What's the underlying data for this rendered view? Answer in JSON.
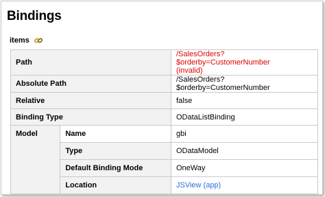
{
  "header": {
    "title": "Bindings"
  },
  "section": {
    "label": "items",
    "icon": "chain-link-icon"
  },
  "rows": {
    "path": {
      "label": "Path",
      "value_line1": "/SalesOrders?$orderby=CustomerNumber",
      "value_line2": "(invalid)"
    },
    "absolute_path": {
      "label": "Absolute Path",
      "value": "/SalesOrders?$orderby=CustomerNumber"
    },
    "relative": {
      "label": "Relative",
      "value": "false"
    },
    "binding_type": {
      "label": "Binding Type",
      "value": "ODataListBinding"
    },
    "model": {
      "label": "Model",
      "name": {
        "label": "Name",
        "value": "gbi"
      },
      "type": {
        "label": "Type",
        "value": "ODataModel"
      },
      "default_binding_mode": {
        "label": "Default Binding Mode",
        "value": "OneWay"
      },
      "location": {
        "label": "Location",
        "value": "JSView (app)"
      }
    }
  },
  "colors": {
    "error": "#e00000",
    "link": "#2a6fd8",
    "key_bg": "#f2f2f2",
    "border": "#c9c9c9"
  }
}
